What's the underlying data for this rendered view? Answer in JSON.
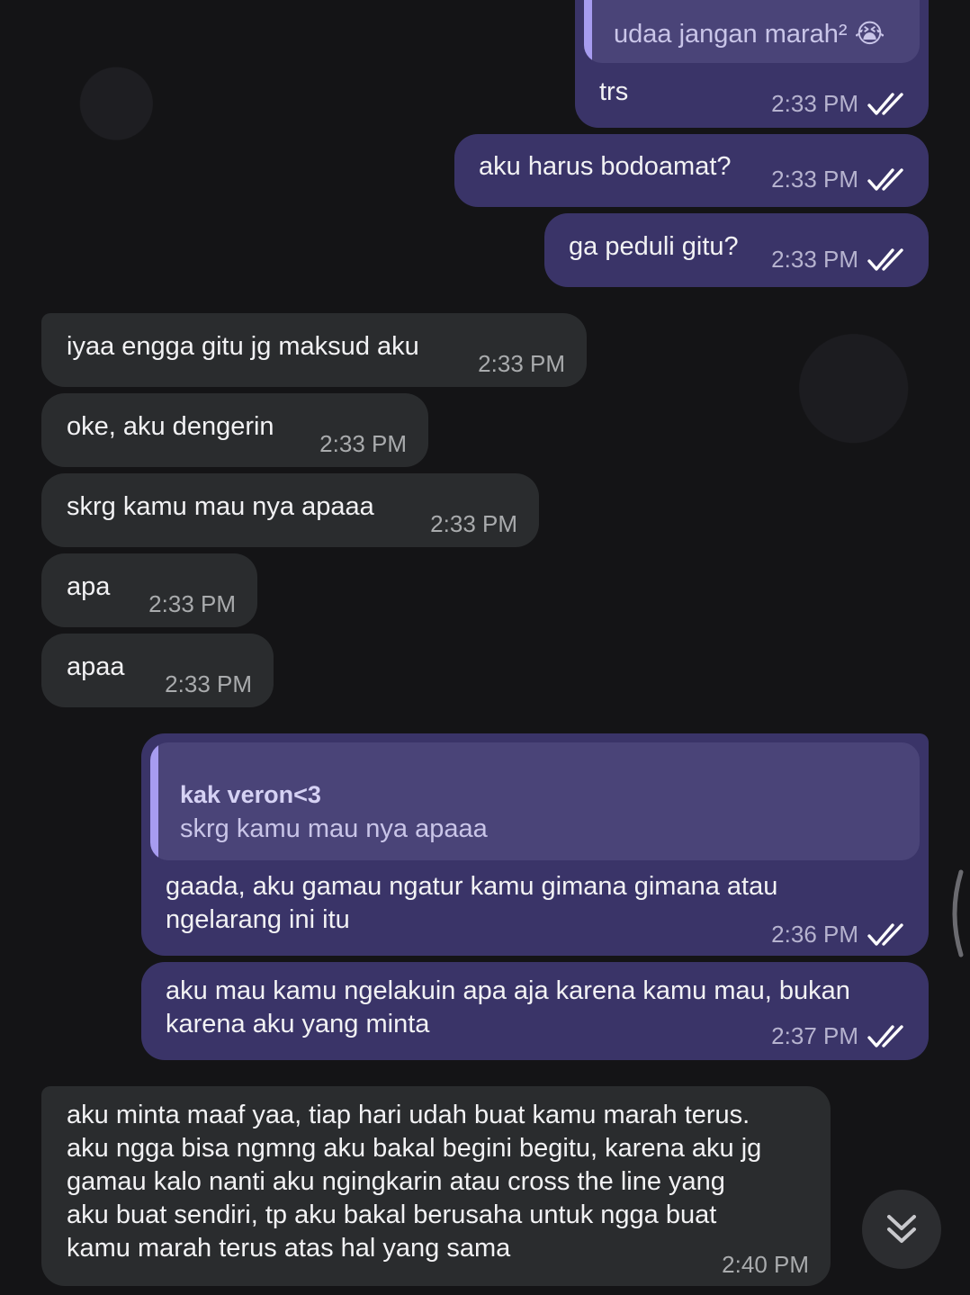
{
  "messages": {
    "m1": {
      "quote": "udaa jangan marah² 😭",
      "text": "trs",
      "time": "2:33 PM"
    },
    "m2": {
      "text": "aku harus bodoamat?",
      "time": "2:33 PM"
    },
    "m3": {
      "text": "ga peduli gitu?",
      "time": "2:33 PM"
    },
    "m4": {
      "text": "iyaa engga gitu jg maksud aku",
      "time": "2:33 PM"
    },
    "m5": {
      "text": "oke, aku dengerin",
      "time": "2:33 PM"
    },
    "m6": {
      "text": "skrg kamu mau nya apaaa",
      "time": "2:33 PM"
    },
    "m7": {
      "text": "apa",
      "time": "2:33 PM"
    },
    "m8": {
      "text": "apaa",
      "time": "2:33 PM"
    },
    "m9": {
      "quote_author": "kak veron<3",
      "quote_text": "skrg kamu mau nya apaaa",
      "text": "gaada, aku gamau ngatur kamu gimana gimana atau\nngelarang ini itu",
      "time": "2:36 PM"
    },
    "m10": {
      "text": "aku mau kamu ngelakuin apa aja karena kamu mau, bukan\nkarena aku yang minta",
      "time": "2:37 PM"
    },
    "m11": {
      "text": "aku minta maaf yaa, tiap hari udah buat kamu marah terus.\naku ngga bisa ngmng aku bakal begini begitu, karena aku jg\ngamau kalo nanti aku ngingkarin atau cross the line yang\naku buat sendiri, tp aku bakal berusaha untuk ngga buat\nkamu marah terus atas hal yang sama",
      "time": "2:40 PM"
    }
  },
  "icons": {
    "read_receipt": "double-check-icon",
    "scroll_down": "double-chevron-down-icon"
  },
  "colors": {
    "outgoing_bubble": "#3a3468",
    "incoming_bubble": "#2a2c2e",
    "quote_bar": "#a79cf0",
    "background": "#141416"
  }
}
